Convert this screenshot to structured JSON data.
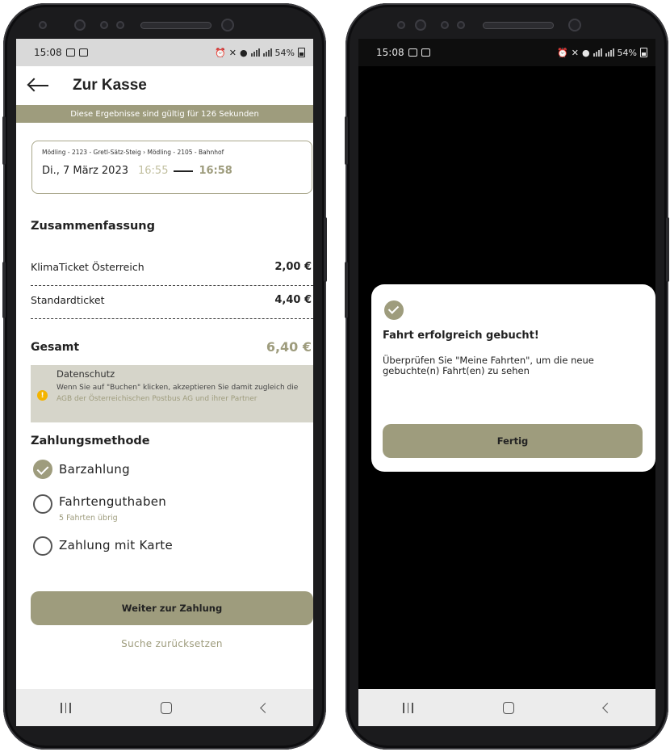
{
  "status_bar": {
    "time": "15:08",
    "battery": "54%"
  },
  "checkout": {
    "title": "Zur Kasse",
    "validity_banner": "Diese Ergebnisse sind gültig für  126 Sekunden",
    "trip": {
      "route": "Mödling - 2123 - Gretl-Sätz-Steig › Mödling - 2105 - Bahnhof",
      "date": "Di., 7 März 2023",
      "departure": "16:55",
      "arrival": "16:58"
    },
    "summary_title": "Zusammenfassung",
    "line_items": [
      {
        "label": "KlimaTicket Österreich",
        "price": "2,00 €"
      },
      {
        "label": "Standardticket",
        "price": "4,40 €"
      }
    ],
    "total_label": "Gesamt",
    "total_value": "6,40 €",
    "privacy": {
      "title": "Datenschutz",
      "text_before": "Wenn Sie auf \"Buchen\" klicken, akzeptieren Sie damit zugleich die ",
      "link": "AGB der Österreichischen Postbus AG und ihrer Partner"
    },
    "payment_title": "Zahlungsmethode",
    "payment_options": [
      {
        "label": "Barzahlung",
        "selected": true
      },
      {
        "label": "Fahrtenguthaben",
        "sub": "5 Fahrten übrig",
        "selected": false
      },
      {
        "label": "Zahlung mit Karte",
        "selected": false
      }
    ],
    "continue_button": "Weiter zur Zahlung",
    "reset_link": "Suche zurücksetzen"
  },
  "confirmation_dialog": {
    "title": "Fahrt erfolgreich gebucht!",
    "message": "Überprüfen Sie \"Meine Fahrten\", um die neue gebuchte(n) Fahrt(en) zu sehen",
    "button": "Fertig"
  },
  "colors": {
    "accent": "#9e9c7d",
    "accent_light": "#c1bf9f",
    "privacy_bg": "#d6d5ca",
    "info": "#f4b400"
  },
  "icons": [
    "back-arrow-icon",
    "info-icon",
    "check-circle-icon",
    "radio-checked-icon",
    "radio-empty-icon",
    "nav-recent-icon",
    "nav-home-icon",
    "nav-back-icon"
  ]
}
